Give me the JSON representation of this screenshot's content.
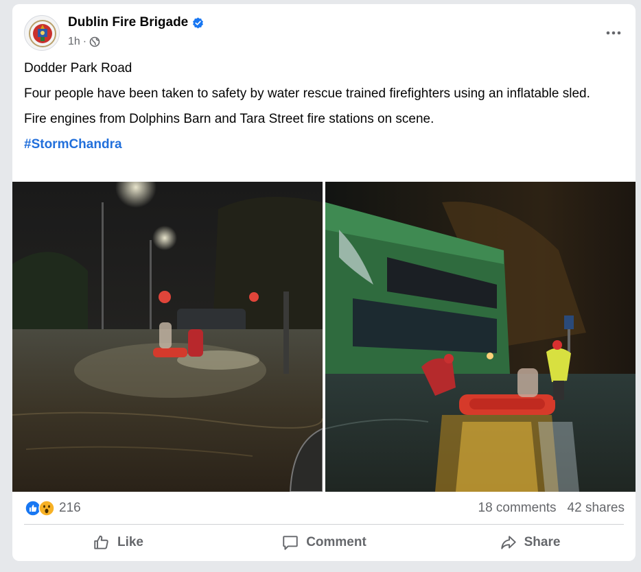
{
  "post": {
    "page_name": "Dublin Fire Brigade",
    "time": "1h",
    "separator": "·",
    "location_line": "Dodder Park Road",
    "body_line1": "Four people have been taken to safety by water rescue trained firefighters using an inflatable sled.",
    "body_line2": "Fire engines from Dolphins Barn and Tara Street fire stations on scene.",
    "hashtag": "#StormChandra"
  },
  "stats": {
    "reaction_count": "216",
    "comments": "18 comments",
    "shares": "42 shares"
  },
  "actions": {
    "like": "Like",
    "comment": "Comment",
    "share": "Share"
  },
  "colors": {
    "link": "#216fdb",
    "like_blue": "#1877f2",
    "wow_yellow": "#f7b125",
    "muted": "#65676b"
  },
  "icons": [
    "fire-brigade-crest-icon",
    "verified-badge-icon",
    "globe-icon",
    "more-options-icon",
    "like-reaction-icon",
    "wow-reaction-icon",
    "thumbs-up-icon",
    "comment-icon",
    "share-arrow-icon"
  ]
}
